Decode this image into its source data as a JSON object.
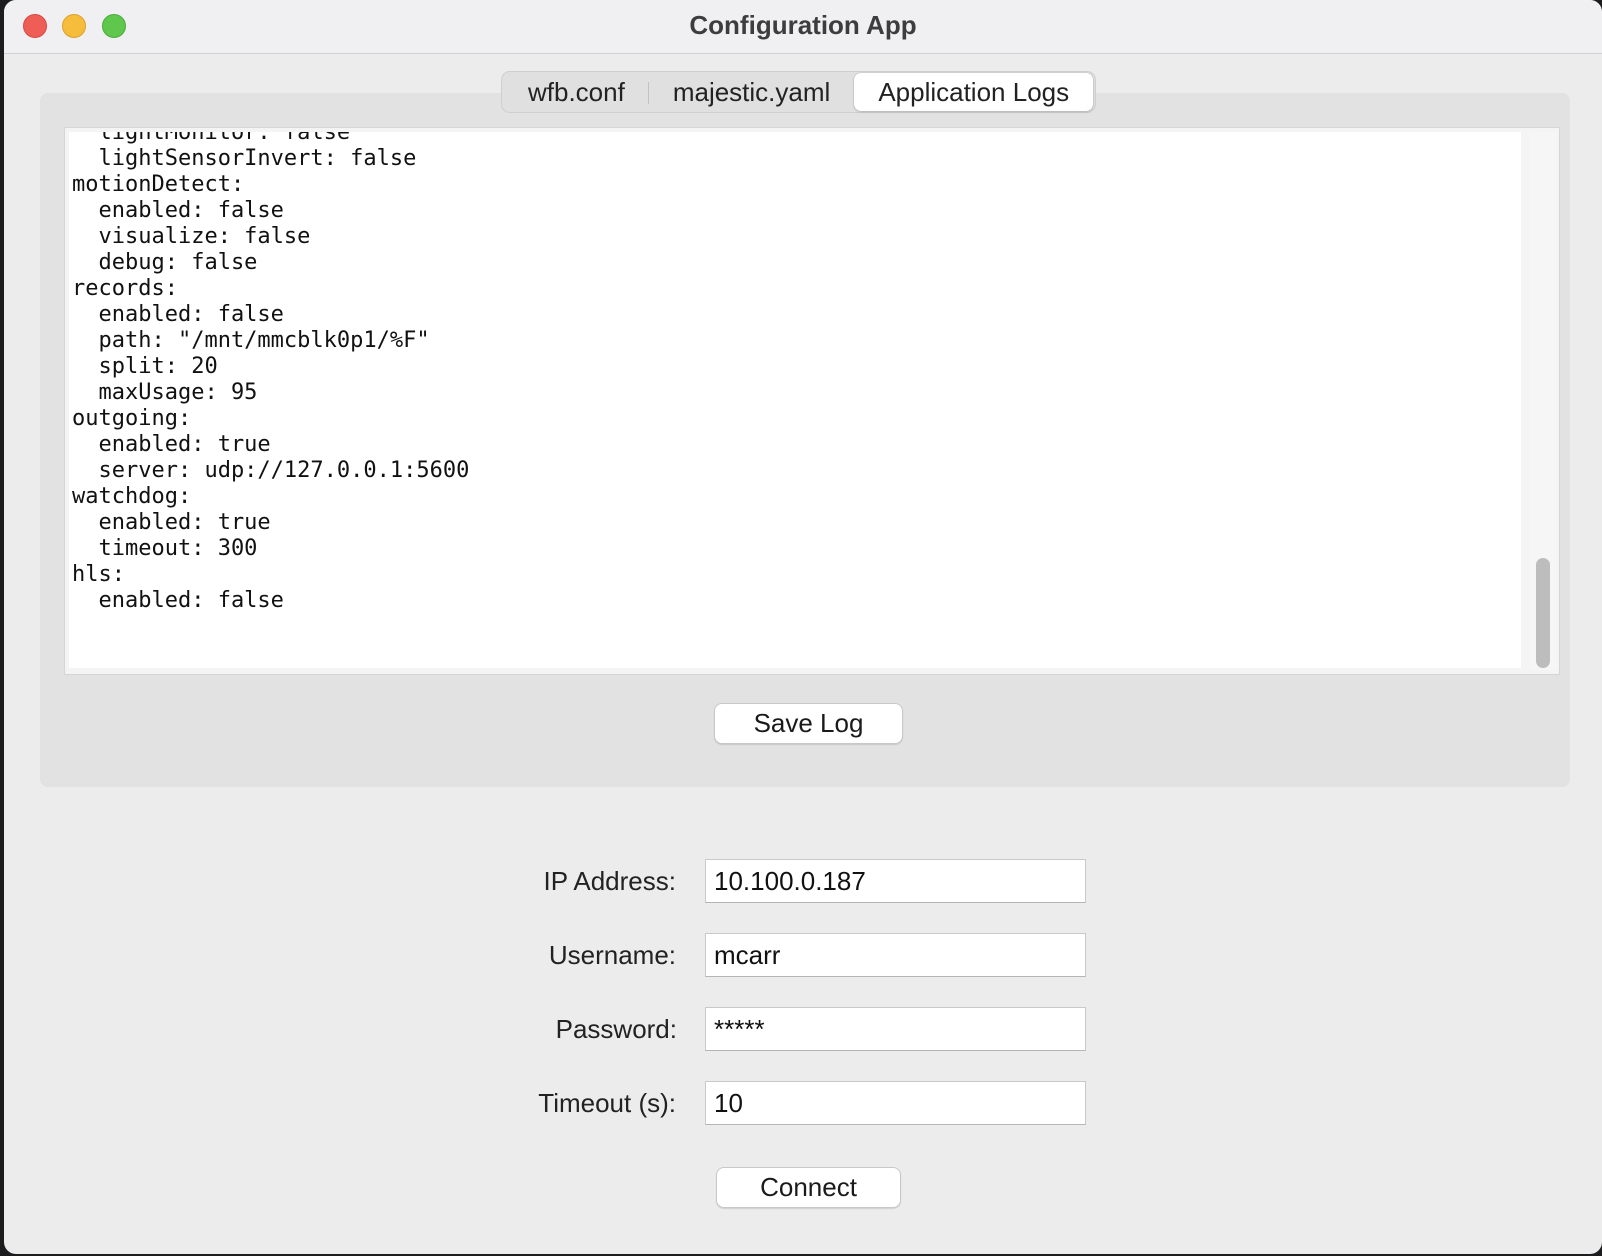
{
  "window": {
    "title": "Configuration App"
  },
  "tabs": [
    {
      "label": "wfb.conf",
      "active": false
    },
    {
      "label": "majestic.yaml",
      "active": false
    },
    {
      "label": "Application Logs",
      "active": true
    }
  ],
  "log": {
    "text": "  lightMonitor: false\n  lightSensorInvert: false\nmotionDetect:\n  enabled: false\n  visualize: false\n  debug: false\nrecords:\n  enabled: false\n  path: \"/mnt/mmcblk0p1/%F\"\n  split: 20\n  maxUsage: 95\noutgoing:\n  enabled: true\n  server: udp://127.0.0.1:5600\nwatchdog:\n  enabled: true\n  timeout: 300\nhls:\n  enabled: false",
    "save_label": "Save Log"
  },
  "form": {
    "ip_label": "IP Address:",
    "ip_value": "10.100.0.187",
    "username_label": "Username:",
    "username_value": "mcarr",
    "password_label": "Password:",
    "password_value": "*****",
    "timeout_label": "Timeout (s):",
    "timeout_value": "10",
    "connect_label": "Connect"
  },
  "colors": {
    "close": "#ee5e57",
    "minimize": "#f6bd3c",
    "zoom": "#5fc74c"
  }
}
